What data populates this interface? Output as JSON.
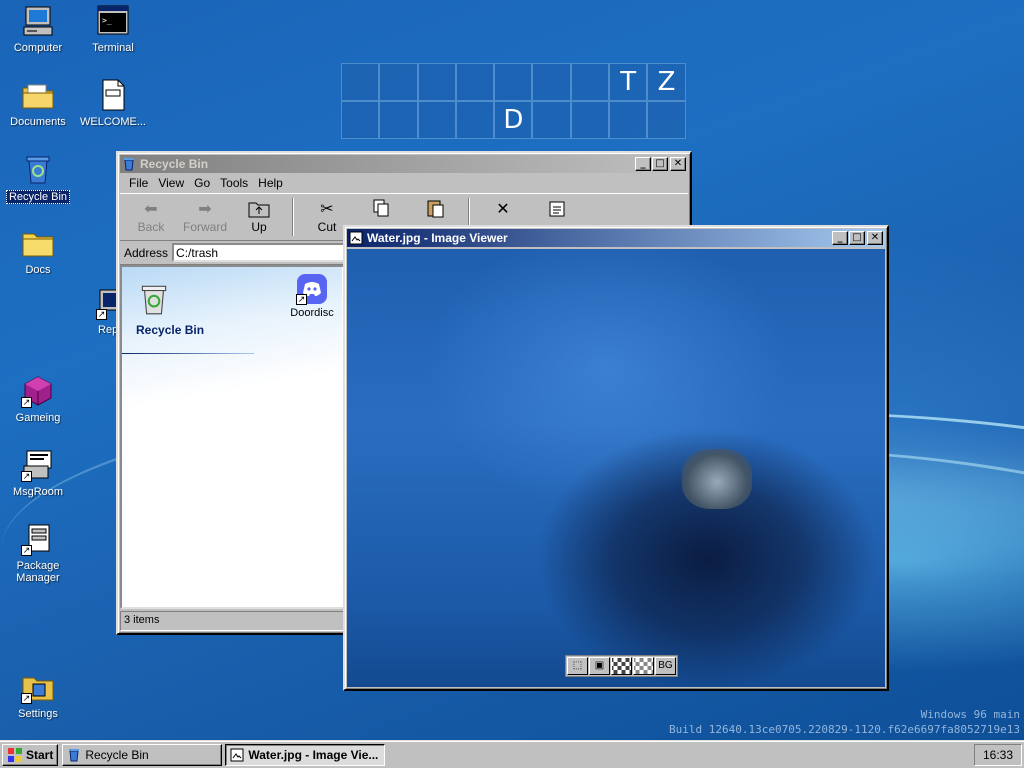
{
  "desktop": {
    "icons": [
      {
        "label": "Computer"
      },
      {
        "label": "Terminal"
      },
      {
        "label": "Documents"
      },
      {
        "label": "WELCOME..."
      },
      {
        "label": "Recycle Bin"
      },
      {
        "label": "Docs"
      },
      {
        "label": "Repor"
      },
      {
        "label": "Gameing"
      },
      {
        "label": "MsgRoom"
      },
      {
        "label": "Package Manager"
      },
      {
        "label": "Settings"
      }
    ],
    "grid_letters": [
      "T",
      "Z",
      "D"
    ],
    "build_line1": "Windows 96 main",
    "build_line2": "Build 12640.13ce0705.220829-1120.f62e6697fa8052719e13"
  },
  "recycle_window": {
    "title": "Recycle Bin",
    "menu": [
      "File",
      "View",
      "Go",
      "Tools",
      "Help"
    ],
    "toolbar": {
      "back": "Back",
      "forward": "Forward",
      "up": "Up",
      "cut": "Cut"
    },
    "address_label": "Address",
    "address_value": "C:/trash",
    "panel_title": "Recycle Bin",
    "items": [
      {
        "label": "Doordisc"
      }
    ],
    "status": "3 items"
  },
  "viewer_window": {
    "title": "Water.jpg - Image Viewer",
    "bg_button": "BG"
  },
  "taskbar": {
    "start": "Start",
    "tasks": [
      {
        "label": "Recycle Bin"
      },
      {
        "label": "Water.jpg - Image Vie..."
      }
    ],
    "clock": "16:33"
  },
  "colors": {
    "titlebar_active": "#0a246a",
    "window_face": "#c0c0c0",
    "desktop_blue": "#1d6fc2"
  }
}
